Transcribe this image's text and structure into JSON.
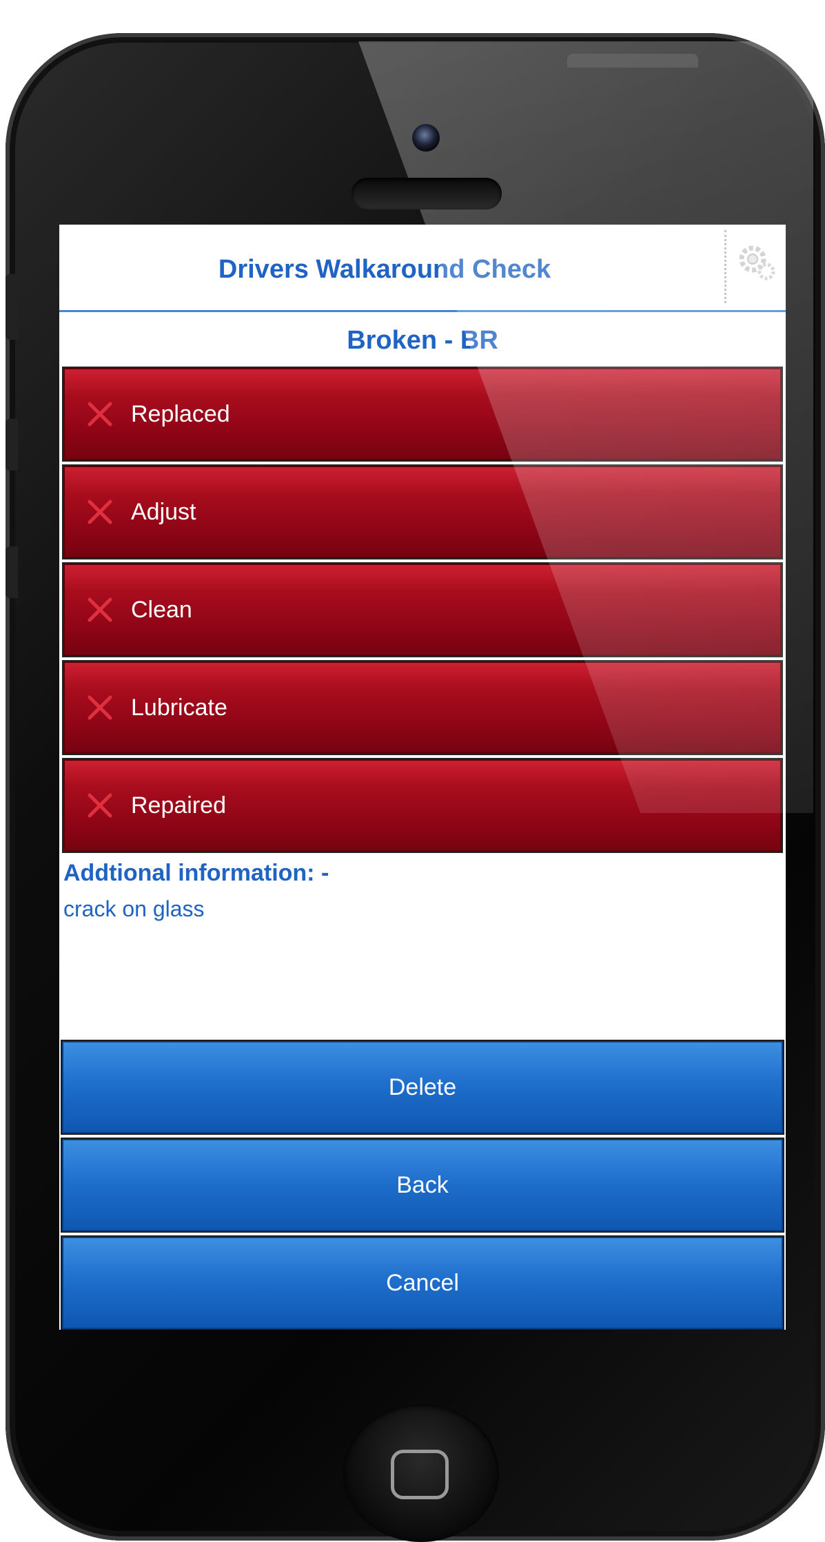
{
  "app": {
    "title": "Drivers Walkaround Check",
    "settings_icon": "gear-wrench-icon"
  },
  "section": {
    "title": "Broken - BR"
  },
  "actions": [
    {
      "label": "Replaced",
      "icon": "red-x-icon"
    },
    {
      "label": "Adjust",
      "icon": "red-x-icon"
    },
    {
      "label": "Clean",
      "icon": "red-x-icon"
    },
    {
      "label": "Lubricate",
      "icon": "red-x-icon"
    },
    {
      "label": "Repaired",
      "icon": "red-x-icon"
    }
  ],
  "info": {
    "heading": "Addtional information: -",
    "text": "crack on glass"
  },
  "buttons": {
    "delete": "Delete",
    "back": "Back",
    "cancel": "Cancel"
  },
  "colors": {
    "accent_blue": "#1f63c4",
    "action_red": "#a80d1d",
    "button_blue": "#1f6fcd"
  }
}
